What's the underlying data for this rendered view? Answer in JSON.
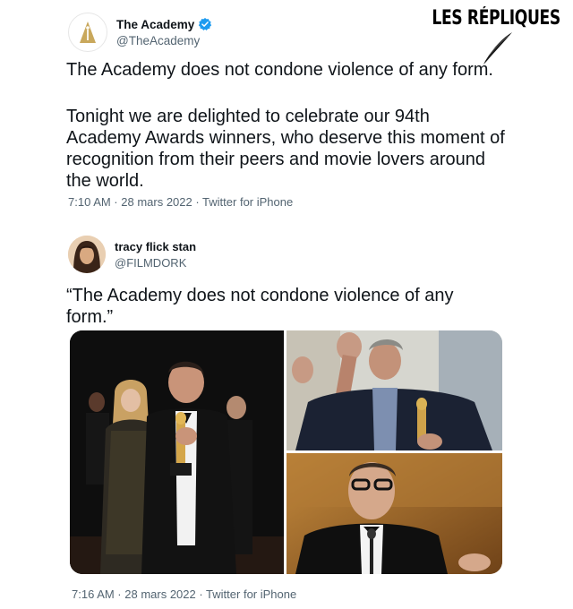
{
  "watermark": "LES RÉPLIQUES",
  "tweet1": {
    "author_name": "The Academy",
    "handle": "@TheAcademy",
    "avatar_icon": "oscar-statuette-icon",
    "verified_icon": "verified-badge-icon",
    "line1": "The Academy does not condone violence of any form.",
    "paragraph2_lines": [
      "Tonight we are delighted to celebrate our 94th",
      "Academy Awards winners, who deserve this moment of",
      "recognition from their peers and movie lovers around",
      "the world."
    ],
    "timestamp": "7:10 AM · 28 mars 2022 · Twitter for iPhone"
  },
  "tweet2": {
    "author_name": "tracy flick stan",
    "handle": "@FILMDORK",
    "text_lines": [
      "“The Academy does not condone violence of any",
      "form.”"
    ],
    "timestamp": "7:16 AM · 28 mars 2022 · Twitter for iPhone"
  },
  "colors": {
    "text": "#0f1419",
    "secondary": "#536471",
    "verified": "#1d9bf0",
    "oscar_gold": "#c9a85c"
  }
}
